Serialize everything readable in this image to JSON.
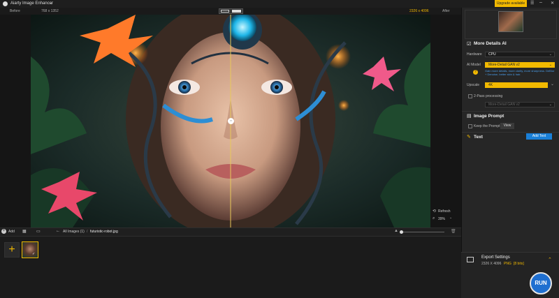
{
  "app": {
    "title": "Aiarty Image Enhancer",
    "upgrade_label": "Upgrade available"
  },
  "compare": {
    "before_label": "Before",
    "after_label": "After",
    "before_size": "768 x 1352",
    "after_size": "2326 x 4096"
  },
  "canvas_controls": {
    "refresh_label": "Refresh",
    "zoom": "39%"
  },
  "bottom": {
    "add_label": "Add",
    "breadcrumb_all": "All Images (1)",
    "breadcrumb_sep": "/",
    "breadcrumb_file": "futuristic-robot.jpg"
  },
  "panel": {
    "section_title": "More Details AI",
    "hardware_label": "Hardware",
    "hardware_value": "CPU",
    "ai_model_label": "AI Model",
    "ai_model_value": "More-Detail GAN v2",
    "ai_model_desc": "Gain more details, more clarity, more sharpness. DeBlur + Denoise, better skin & hair.",
    "upscale_label": "Upscale",
    "upscale_value": "4K",
    "two_pass_label": "2-Pass processing",
    "two_pass_value": "More-Detail GAN v2",
    "image_prompt_title": "Image Prompt",
    "keep_prompt_label": "Keep the Prompt",
    "view_label": "View",
    "text_title": "Text",
    "add_text_label": "Add Text"
  },
  "export": {
    "title": "Export Settings",
    "size": "2326 X 4096",
    "format": "PNG",
    "bits": "[8 bits]",
    "run_label": "RUN"
  },
  "colors": {
    "accent": "#f2b900",
    "blue": "#1a7fd6",
    "run": "#1f6fd0",
    "compare_line": "#e8c85a"
  }
}
